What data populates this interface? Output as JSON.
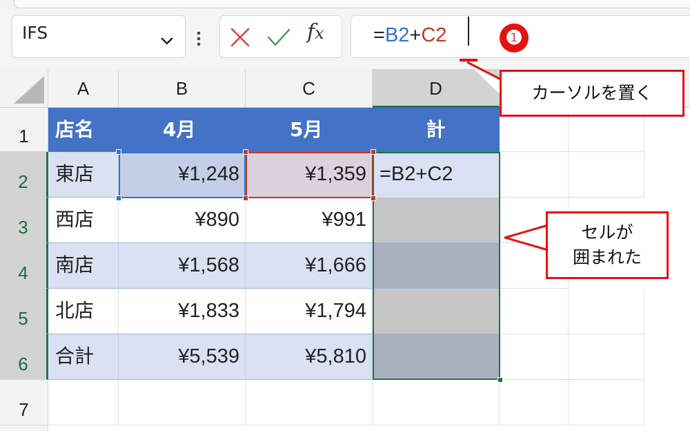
{
  "formula_bar": {
    "name_box_value": "IFS",
    "icons": {
      "name_box_dropdown": "chevron-down-icon",
      "more": "vertical-ellipsis-icon",
      "cancel": "cancel-x-icon",
      "enter": "enter-check-icon",
      "insert_function": "fx-icon"
    },
    "fx_label_f": "f",
    "fx_label_x": "x",
    "formula_parts": {
      "eq": "=",
      "ref1": "B2",
      "op": "+",
      "ref2": "C2"
    }
  },
  "annotations": {
    "step_number": "❶",
    "cursor_callout": "カーソルを置く",
    "cells_callout_line1": "セルが",
    "cells_callout_line2": "囲まれた"
  },
  "sheet": {
    "column_headers": [
      "A",
      "B",
      "C",
      "D"
    ],
    "active_column": "D",
    "row_headers": [
      "1",
      "2",
      "3",
      "4",
      "5",
      "6",
      "7"
    ],
    "header_row": [
      "店名",
      "4月",
      "5月",
      "計"
    ],
    "rows": [
      {
        "store": "東店",
        "apr": "¥1,248",
        "may": "¥1,359",
        "total": "=B2+C2"
      },
      {
        "store": "西店",
        "apr": "¥890",
        "may": "¥991",
        "total": ""
      },
      {
        "store": "南店",
        "apr": "¥1,568",
        "may": "¥1,666",
        "total": ""
      },
      {
        "store": "北店",
        "apr": "¥1,833",
        "may": "¥1,794",
        "total": ""
      },
      {
        "store": "合計",
        "apr": "¥5,539",
        "may": "¥5,810",
        "total": ""
      }
    ]
  },
  "colors": {
    "table_header": "#4472c4",
    "band_row": "#d9e1f2",
    "ref_b2_border": "#2e75c9",
    "ref_c2_border": "#c0392b",
    "selection_border": "#217346",
    "callout_red": "#e81010"
  }
}
